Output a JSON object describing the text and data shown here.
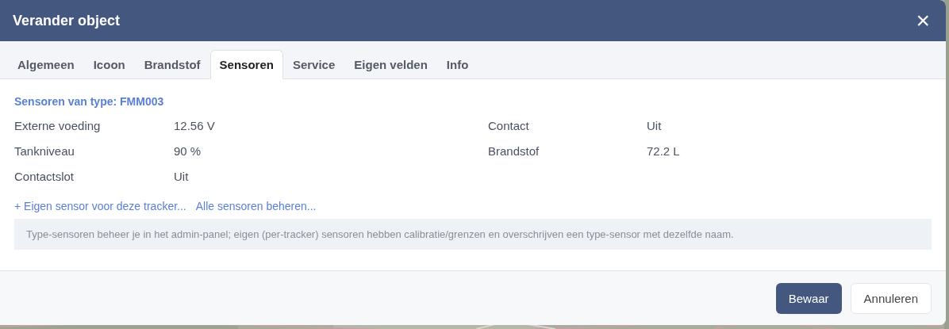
{
  "dialog": {
    "title": "Verander object",
    "close": "×"
  },
  "tabs": [
    {
      "label": "Algemeen",
      "selected": false
    },
    {
      "label": "Icoon",
      "selected": false
    },
    {
      "label": "Brandstof",
      "selected": false
    },
    {
      "label": "Sensoren",
      "selected": true
    },
    {
      "label": "Service",
      "selected": false
    },
    {
      "label": "Eigen velden",
      "selected": false
    },
    {
      "label": "Info",
      "selected": false
    }
  ],
  "section_title": "Sensoren van type: FMM003",
  "sensors": [
    {
      "label": "Externe voeding",
      "value": "12.56 V"
    },
    {
      "label": "Contact",
      "value": "Uit"
    },
    {
      "label": "Tankniveau",
      "value": "90 %"
    },
    {
      "label": "Brandstof",
      "value": "72.2 L"
    },
    {
      "label": "Contactslot",
      "value": "Uit"
    }
  ],
  "links": [
    "+ Eigen sensor voor deze tracker...",
    "Alle sensoren beheren..."
  ],
  "note": "Type-sensoren beheer je in het admin-panel; eigen (per-tracker) sensoren hebben calibratie/grenzen en overschrijven een type-sensor met dezelfde naam.",
  "buttons": [
    {
      "label": "Bewaar",
      "kind": "primary"
    },
    {
      "label": "Annuleren",
      "kind": "secondary"
    }
  ]
}
